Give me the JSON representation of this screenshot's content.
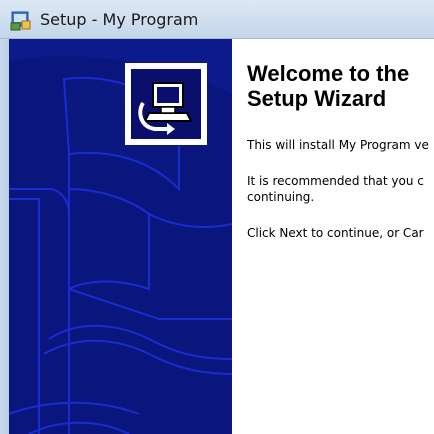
{
  "window": {
    "title": "Setup - My Program",
    "icon": "setup-installer-icon"
  },
  "banner": {
    "logo_icon": "computer-install-icon",
    "colors": {
      "background": "#0d1a8c",
      "shape": "#0a1880",
      "outline": "#1a2bd1"
    }
  },
  "welcome": {
    "heading_line1": "Welcome to the",
    "heading_line2": "Setup Wizard",
    "paragraph1": "This will install My Program ve",
    "paragraph2_line1": "It is recommended that you c",
    "paragraph2_line2": "continuing.",
    "paragraph3": "Click Next to continue, or Car"
  }
}
